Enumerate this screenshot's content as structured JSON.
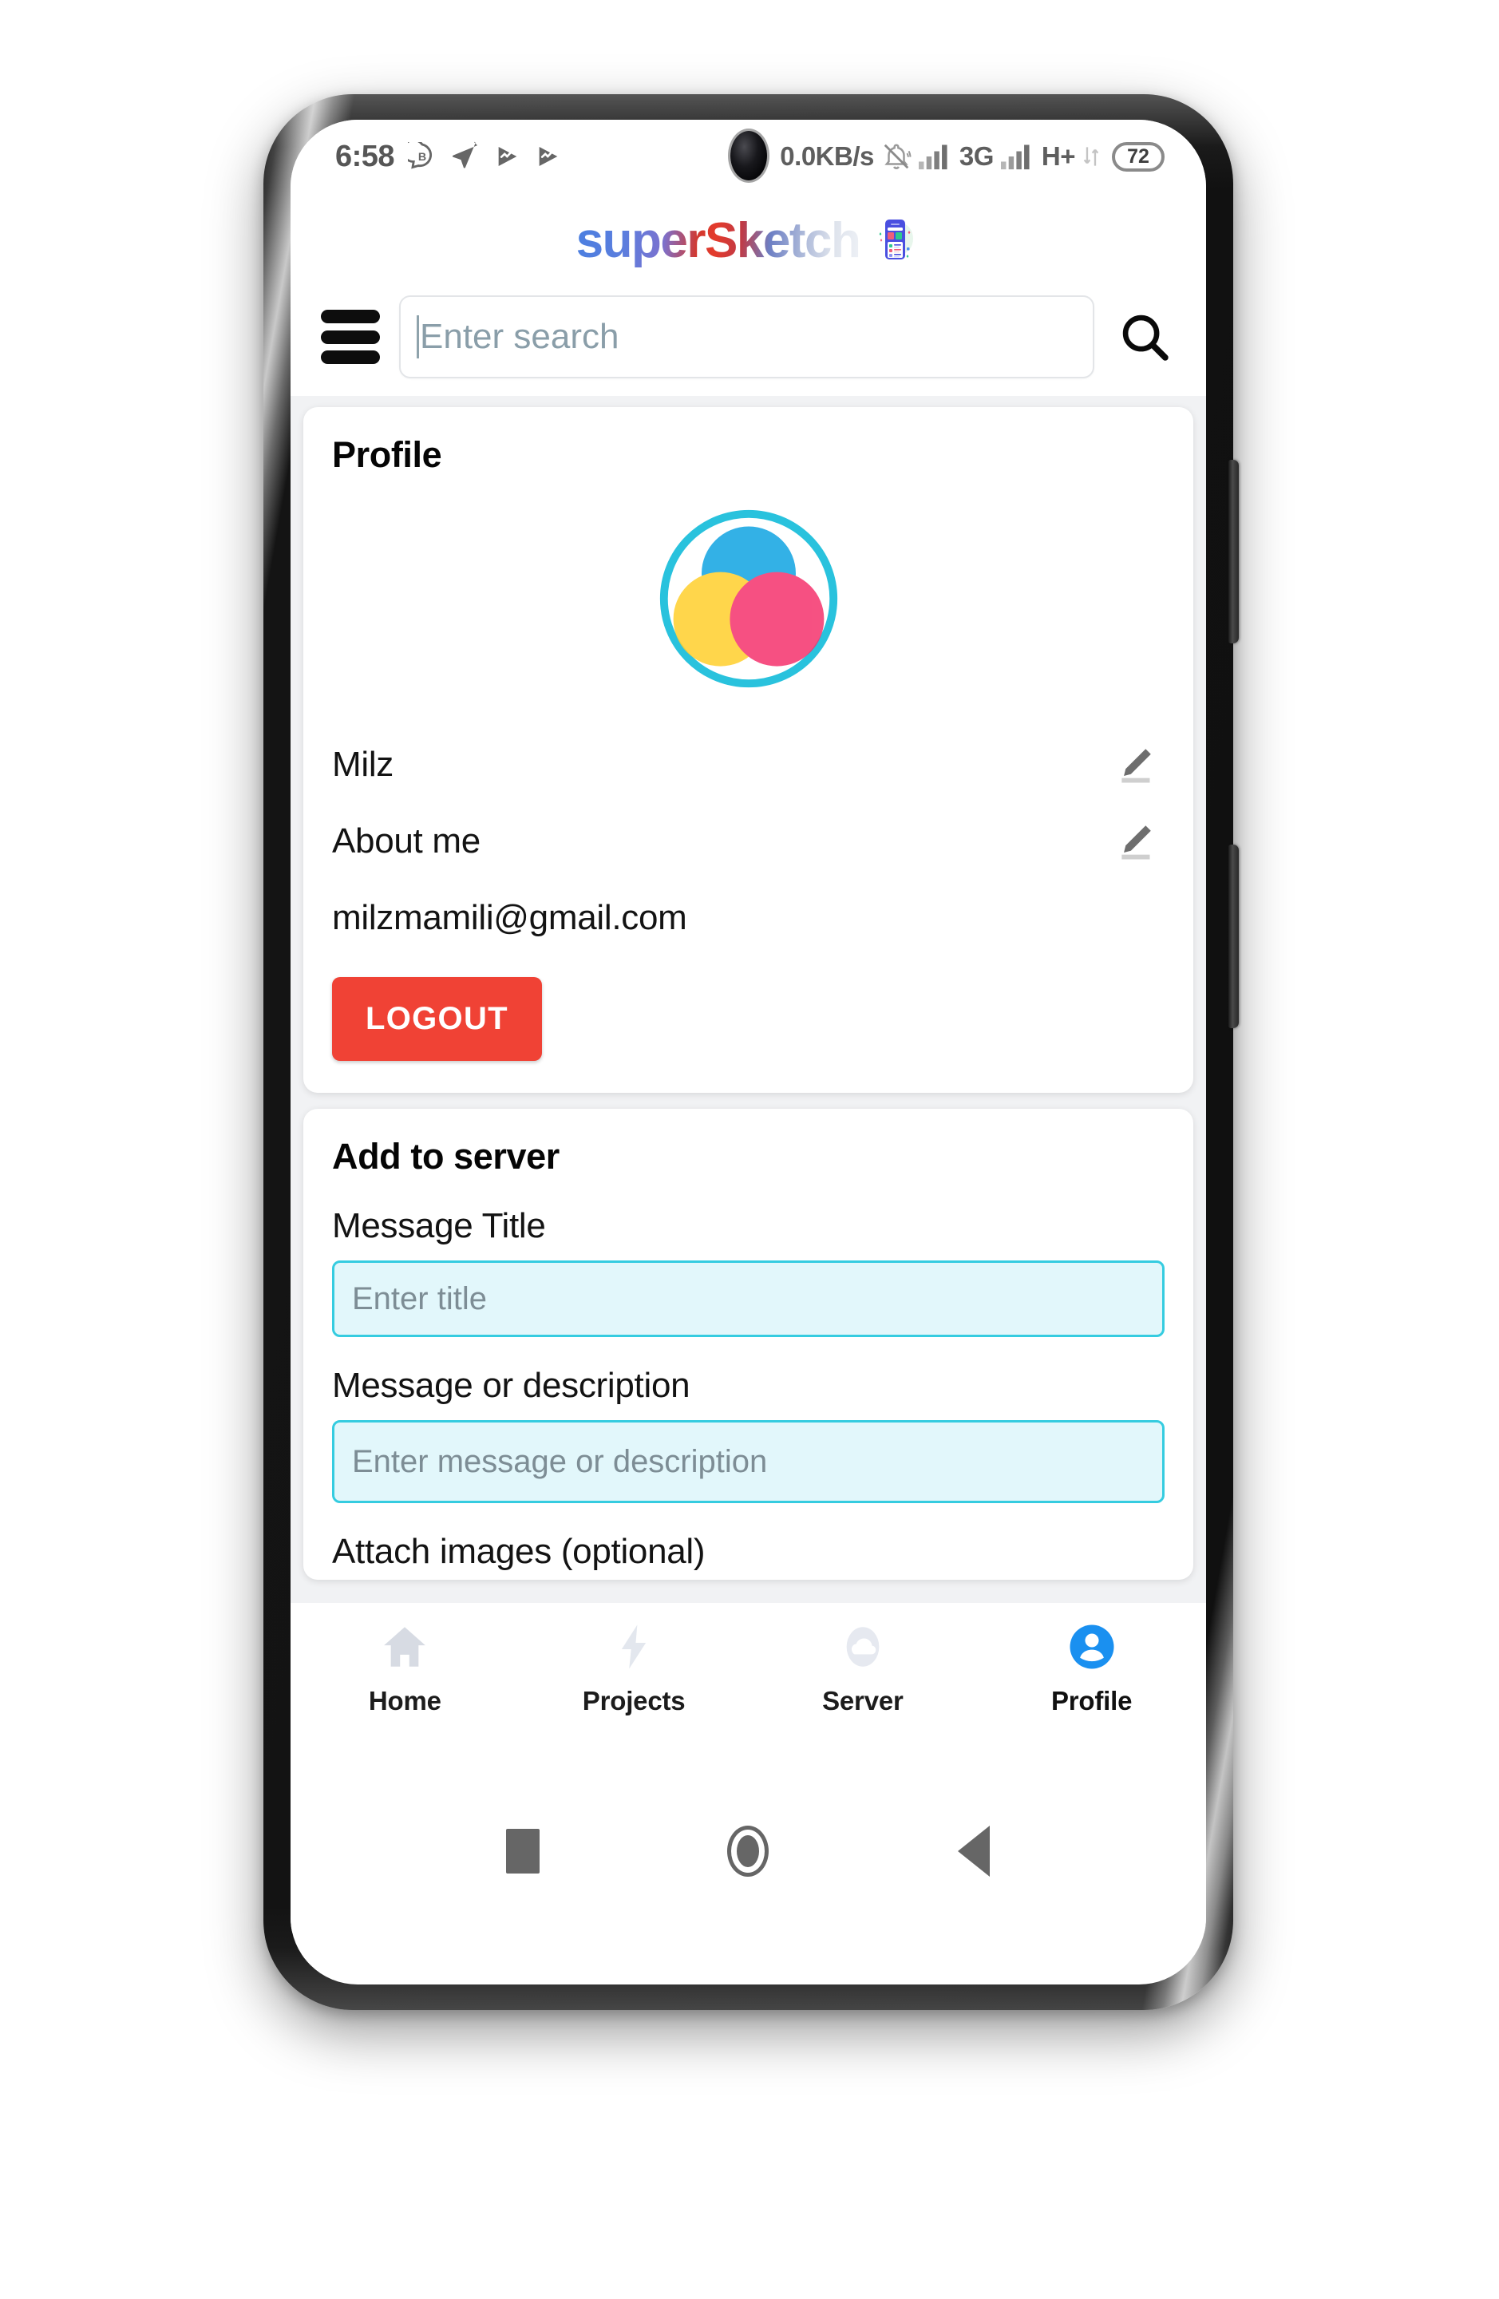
{
  "status_bar": {
    "time": "6:58",
    "left_icons": [
      "chat-b-icon",
      "send-icon",
      "play-wave-icon",
      "play-wave-icon"
    ],
    "network_speed": "0.0KB/s",
    "silent_icon": "bell-off-icon",
    "signal_1_icon": "signal-bars-icon",
    "network_generation": "3G",
    "signal_2_icon": "signal-bars-icon",
    "network_type": "H+",
    "data_arrows_icon": "data-transfer-icon",
    "battery_level": "72"
  },
  "header": {
    "brand_name": "superSketch",
    "brand_icon": "phone-app-illustration-icon"
  },
  "search": {
    "menu_icon": "hamburger-menu-icon",
    "placeholder": "Enter search",
    "value": "",
    "search_icon": "search-icon"
  },
  "profile_card": {
    "title": "Profile",
    "avatar_icon": "venn-diagram-avatar",
    "avatar_colors": {
      "ring": "#29c2dd",
      "blue": "#1aa7e0",
      "yellow": "#ffd23c",
      "pink": "#f5346e"
    },
    "rows": [
      {
        "text": "Milz",
        "edit_icon": "pencil-edit-icon",
        "editable": true
      },
      {
        "text": "About me",
        "edit_icon": "pencil-edit-icon",
        "editable": true
      },
      {
        "text": "milzmamili@gmail.com",
        "editable": false
      }
    ],
    "logout_label": "LOGOUT",
    "logout_color": "#f04235"
  },
  "add_to_server_card": {
    "title": "Add to server",
    "fields": [
      {
        "label": "Message Title",
        "placeholder": "Enter title",
        "value": ""
      },
      {
        "label": "Message or description",
        "placeholder": "Enter message or description",
        "value": ""
      }
    ],
    "attach_label": "Attach images (optional)",
    "input_border_color": "#35cce0",
    "input_fill_color": "#e2f7fb"
  },
  "bottom_nav": {
    "active_color": "#1a90f0",
    "inactive_color": "#d7dbe3",
    "items": [
      {
        "label": "Home",
        "icon": "home-icon",
        "active": false
      },
      {
        "label": "Projects",
        "icon": "bolt-icon",
        "active": false
      },
      {
        "label": "Server",
        "icon": "cloud-icon",
        "active": false
      },
      {
        "label": "Profile",
        "icon": "person-icon",
        "active": true
      }
    ]
  },
  "android_nav": {
    "recents_icon": "square-recents-icon",
    "home_icon": "circle-home-icon",
    "back_icon": "triangle-back-icon"
  }
}
